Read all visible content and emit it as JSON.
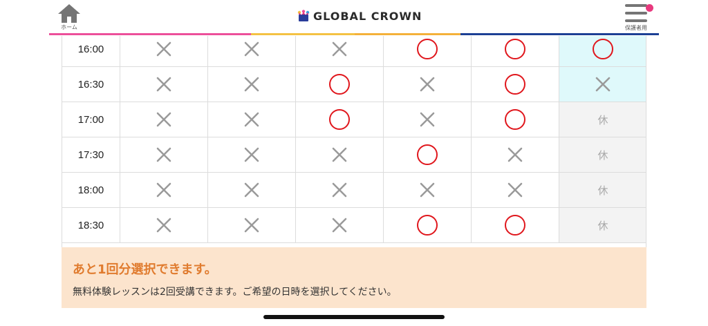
{
  "header": {
    "home_label": "ホーム",
    "home_icon": "house-icon",
    "logo_text": "GLOBAL CROWN",
    "logo_icon": "crown-logo-icon",
    "menu_label": "保護者用",
    "menu_icon": "hamburger-menu-icon",
    "notification_dot_color": "#e8397e",
    "tab_colors": [
      "#ec4f9a",
      "#f4c243",
      "#f4b13a",
      "#1c3f94"
    ]
  },
  "schedule": {
    "status_legend": {
      "available": "circle",
      "unavailable": "cross",
      "closed": "休"
    },
    "closed_label": "休",
    "rows": [
      {
        "time": "16:00",
        "slots": [
          "x",
          "x",
          "x",
          "o",
          "o",
          "o"
        ]
      },
      {
        "time": "16:30",
        "slots": [
          "x",
          "x",
          "o",
          "x",
          "o",
          "x"
        ]
      },
      {
        "time": "17:00",
        "slots": [
          "x",
          "x",
          "o",
          "x",
          "o",
          "closed"
        ]
      },
      {
        "time": "17:30",
        "slots": [
          "x",
          "x",
          "x",
          "o",
          "x",
          "closed"
        ]
      },
      {
        "time": "18:00",
        "slots": [
          "x",
          "x",
          "x",
          "x",
          "x",
          "closed"
        ]
      },
      {
        "time": "18:30",
        "slots": [
          "x",
          "x",
          "x",
          "o",
          "o",
          "closed"
        ]
      }
    ]
  },
  "notice": {
    "title": "あと1回分選択できます。",
    "body": "無料体験レッスンは2回受講できます。ご希望の日時を選択してください。"
  }
}
